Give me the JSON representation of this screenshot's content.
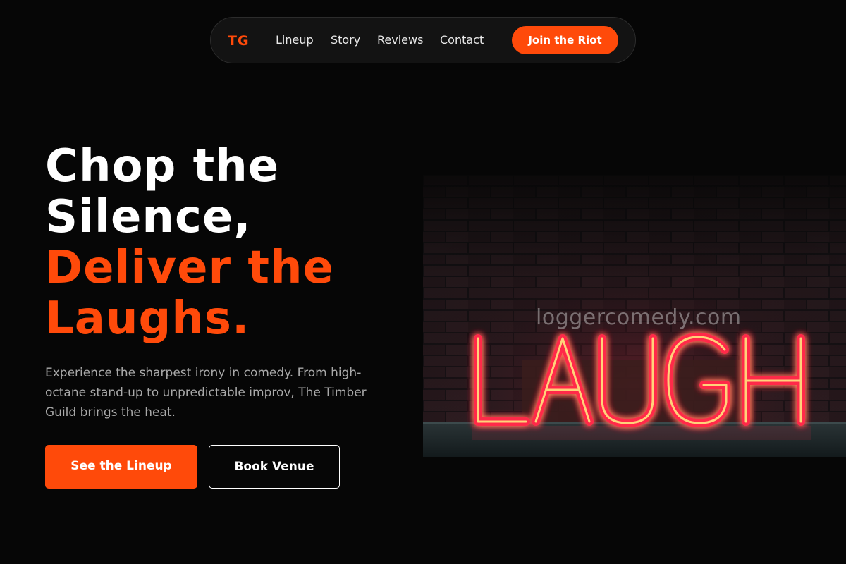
{
  "nav": {
    "logo": "TG",
    "links": [
      "Lineup",
      "Story",
      "Reviews",
      "Contact"
    ],
    "cta": "Join the Riot"
  },
  "hero": {
    "headline_line1": "Chop the",
    "headline_line2": "Silence,",
    "headline_accent_line1": "Deliver the",
    "headline_accent_line2": "Laughs.",
    "description": "Experience the sharpest irony in comedy. From high-octane stand-up to unpredictable improv, The Timber Guild brings the heat.",
    "primary_button": "See the Lineup",
    "secondary_button": "Book Venue"
  },
  "image": {
    "neon_text": "LAUGH",
    "watermark": "loggercomedy.com"
  },
  "colors": {
    "accent": "#ff4a0a",
    "background": "#060606",
    "neon_pink": "#ff2a4a",
    "neon_yellow": "#ffcf6a"
  }
}
